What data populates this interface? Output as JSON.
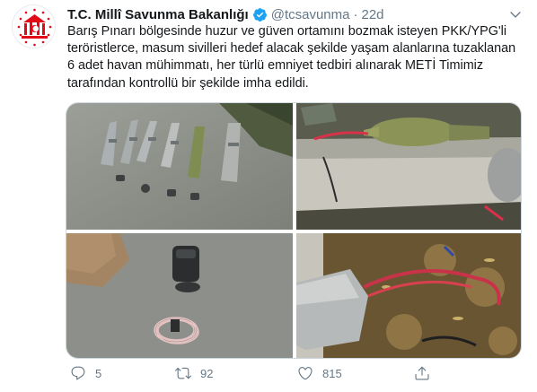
{
  "tweet": {
    "author_name": "T.C. Millî Savunma Bakanlığı",
    "handle": "@tcsavunma",
    "separator": "·",
    "time": "22d",
    "text_lines": [
      "Barış Pınarı bölgesinde huzur ve güven ortamını bozmak isteyen PKK/YPG'li",
      "teröristlerce, masum sivilleri hedef alacak şekilde yaşam alanlarına tuzaklanan",
      "6 adet havan mühimmatı, her türlü emniyet tedbiri alınarak METİ Timimiz",
      "tarafından kontrollü bir şekilde imha edildi."
    ],
    "reply_count": "5",
    "retweet_count": "92",
    "like_count": "815"
  },
  "colors": {
    "text_primary": "#14171a",
    "text_secondary": "#657786",
    "verified": "#1da1f2",
    "avatar_red": "#e30a17"
  },
  "icons": {
    "verified": "verified-badge-icon",
    "caret": "chevron-down-icon",
    "reply": "reply-icon",
    "retweet": "retweet-icon",
    "like": "heart-icon",
    "share": "share-icon"
  }
}
